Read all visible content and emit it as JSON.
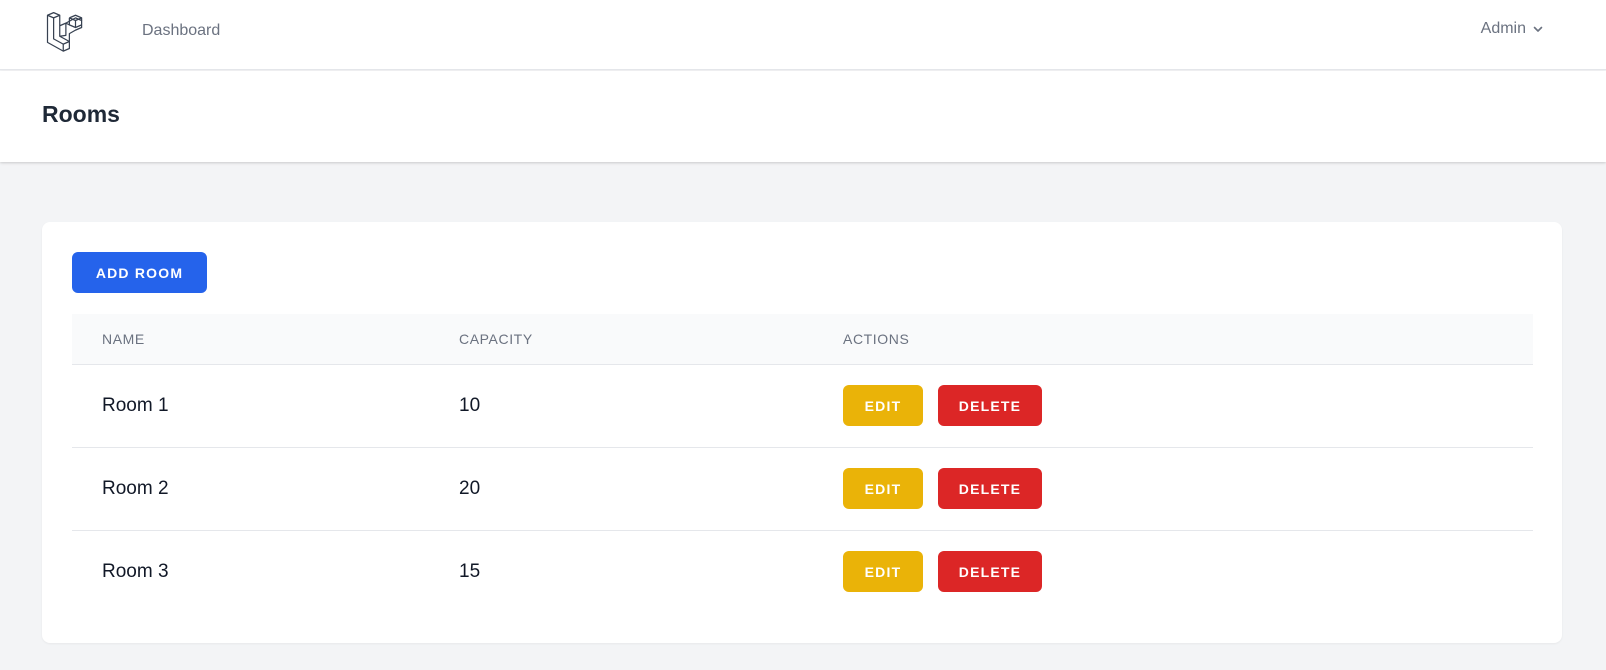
{
  "nav": {
    "logo_icon": "laravel-logo-icon",
    "dashboard_label": "Dashboard",
    "user_label": "Admin",
    "user_menu_icon": "chevron-down-icon"
  },
  "header": {
    "title": "Rooms"
  },
  "toolbar": {
    "add_label": "ADD ROOM"
  },
  "table": {
    "columns": [
      "NAME",
      "CAPACITY",
      "ACTIONS"
    ],
    "rows": [
      {
        "name": "Room 1",
        "capacity": "10",
        "edit_label": "EDIT",
        "delete_label": "DELETE"
      },
      {
        "name": "Room 2",
        "capacity": "20",
        "edit_label": "EDIT",
        "delete_label": "DELETE"
      },
      {
        "name": "Room 3",
        "capacity": "15",
        "edit_label": "EDIT",
        "delete_label": "DELETE"
      }
    ]
  },
  "colors": {
    "primary": "#2563eb",
    "edit": "#eab308",
    "delete": "#dc2626",
    "background": "#f3f4f6"
  }
}
